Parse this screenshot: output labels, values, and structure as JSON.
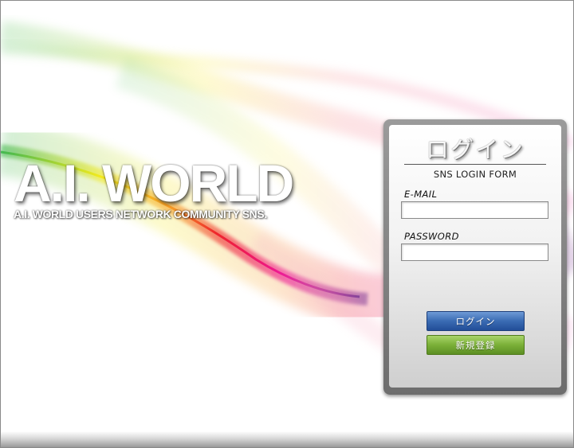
{
  "brand": {
    "title": "A.I. WORLD",
    "subtitle": "A.I. WORLD USERS NETWORK COMMUNITY SNS."
  },
  "login_panel": {
    "title": "ログイン",
    "subtitle": "SNS LOGIN FORM",
    "email_label": "E-MAIL",
    "email_value": "",
    "password_label": "PASSWORD",
    "password_value": "",
    "login_button": "ログイン",
    "register_button": "新規登録"
  },
  "colors": {
    "login_button": "#3a6bb3",
    "register_button": "#7bb038",
    "panel_frame": "#8a8a8a"
  }
}
